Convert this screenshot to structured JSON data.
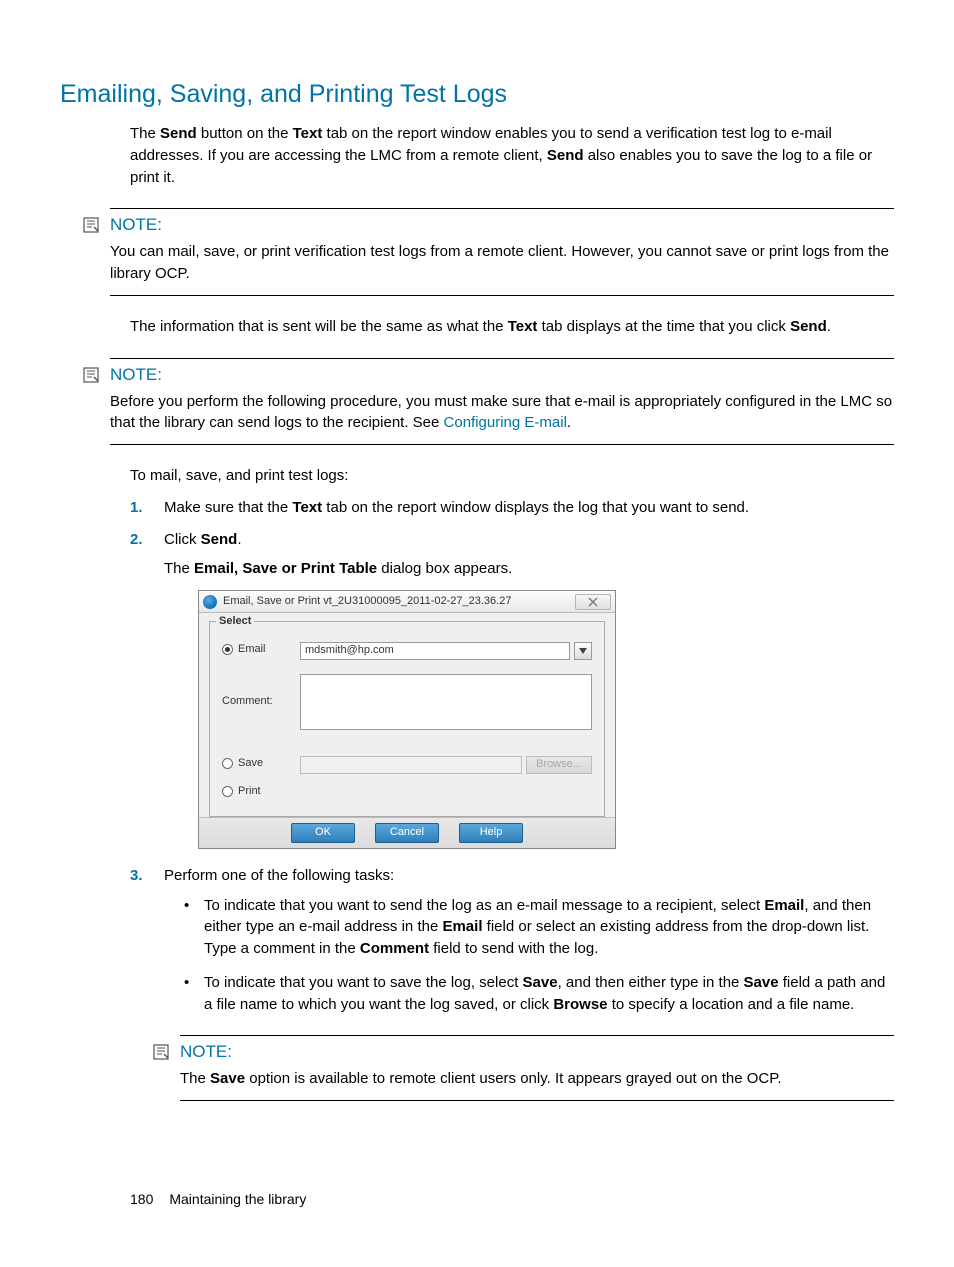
{
  "heading": "Emailing, Saving, and Printing Test Logs",
  "intro": {
    "p1_a": "The ",
    "p1_b_send": "Send",
    "p1_c": " button on the ",
    "p1_d_text": "Text",
    "p1_e": " tab on the report window enables you to send a verification test log to e-mail addresses. If you are accessing the LMC from a remote client, ",
    "p1_f_send": "Send",
    "p1_g": " also enables you to save the log to a file or print it."
  },
  "note1": {
    "label": "NOTE:",
    "body": "You can mail, save, or print verification test logs from a remote client. However, you cannot save or print logs from the library OCP."
  },
  "mid": {
    "a": "The information that is sent will be the same as what the ",
    "b_text": "Text",
    "c": " tab displays at the time that you click ",
    "d_send": "Send",
    "e": "."
  },
  "note2": {
    "label": "NOTE:",
    "body_a": "Before you perform the following procedure, you must make sure that e-mail is appropriately configured in the LMC so that the library can send logs to the recipient. See ",
    "link": "Configuring E-mail",
    "body_b": "."
  },
  "lead": "To mail, save, and print test logs:",
  "steps": {
    "s1_a": "Make sure that the ",
    "s1_b_text": "Text",
    "s1_c": " tab on the report window displays the log that you want to send.",
    "s2_a": "Click ",
    "s2_b_send": "Send",
    "s2_c": ".",
    "s2_desc_a": "The ",
    "s2_desc_b": "Email, Save or Print Table",
    "s2_desc_c": " dialog box appears.",
    "s3": "Perform one of the following tasks:",
    "b1_a": "To indicate that you want to send the log as an e-mail message to a recipient, select ",
    "b1_email": "Email",
    "b1_b": ", and then either type an e-mail address in the ",
    "b1_emailfield": "Email",
    "b1_c": " field or select an existing address from the drop-down list. Type a comment in the ",
    "b1_comment": "Comment",
    "b1_d": " field to send with the log.",
    "b2_a": "To indicate that you want to save the log, select ",
    "b2_save1": "Save",
    "b2_b": ", and then either type in the ",
    "b2_save2": "Save",
    "b2_c": " field a path and a file name to which you want the log saved, or click ",
    "b2_browse": "Browse",
    "b2_d": " to specify a location and a file name."
  },
  "note3": {
    "label": "NOTE:",
    "body_a": "The ",
    "body_save": "Save",
    "body_b": " option is available to remote client users only. It appears grayed out on the OCP."
  },
  "dialog": {
    "title": "Email, Save or Print vt_2U31000095_2011-02-27_23.36.27",
    "legend": "Select",
    "email_radio": "Email",
    "email_value": "mdsmith@hp.com",
    "comment_label": "Comment:",
    "save_radio": "Save",
    "print_radio": "Print",
    "browse": "Browse...",
    "ok": "OK",
    "cancel": "Cancel",
    "help": "Help"
  },
  "footer": {
    "page": "180",
    "section": "Maintaining the library"
  }
}
